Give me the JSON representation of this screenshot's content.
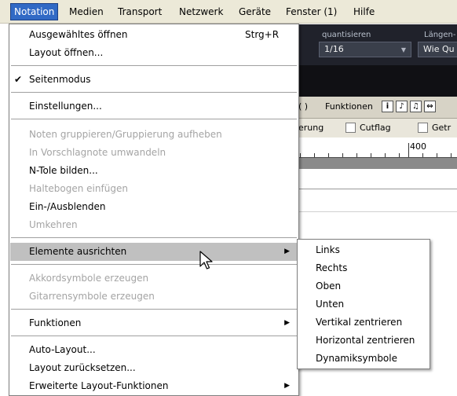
{
  "menubar": {
    "items": [
      "Notation",
      "Medien",
      "Transport",
      "Netzwerk",
      "Geräte",
      "Fenster (1)",
      "Hilfe"
    ]
  },
  "notation_menu": {
    "items": [
      {
        "label": "Ausgewähltes öffnen",
        "shortcut": "Strg+R"
      },
      {
        "label": "Layout öffnen..."
      },
      {
        "label": "Seitenmodus",
        "checked": true
      },
      {
        "label": "Einstellungen..."
      },
      {
        "label": "Noten gruppieren/Gruppierung aufheben",
        "disabled": true
      },
      {
        "label": "In Vorschlagnote umwandeln",
        "disabled": true
      },
      {
        "label": "N-Tole bilden..."
      },
      {
        "label": "Haltebogen einfügen",
        "disabled": true
      },
      {
        "label": "Ein-/Ausblenden"
      },
      {
        "label": "Umkehren",
        "disabled": true
      },
      {
        "label": "Elemente ausrichten",
        "submenu": true,
        "highlighted": true
      },
      {
        "label": "Akkordsymbole erzeugen",
        "disabled": true
      },
      {
        "label": "Gitarrensymbole erzeugen",
        "disabled": true
      },
      {
        "label": "Funktionen",
        "submenu": true
      },
      {
        "label": "Auto-Layout..."
      },
      {
        "label": "Layout zurücksetzen..."
      },
      {
        "label": "Erweiterte Layout-Funktionen",
        "submenu": true
      }
    ]
  },
  "submenu": {
    "items": [
      "Links",
      "Rechts",
      "Oben",
      "Unten",
      "Vertikal zentrieren",
      "Horizontal zentrieren",
      "Dynamiksymbole"
    ]
  },
  "background": {
    "quantize_label": "quantisieren",
    "quantize_value": "1/16",
    "length_label": "Längen-",
    "length_value": "Wie Qu",
    "functions_label": "Funktionen",
    "info_icon": "i",
    "toolbar_text": "erung",
    "cutflag_label": "Cutflag",
    "getr_label": "Getr",
    "ruler_number": "400"
  },
  "icons": {
    "check": "check-mark-icon",
    "submenu_arrow": "triangle-right-icon",
    "cursor": "arrow-pointer-icon"
  },
  "colors": {
    "menubar_bg": "#ece9d8",
    "active_menu": "#316ac5",
    "highlight": "#c0c0c0",
    "disabled_text": "#a4a4a4",
    "dark_toolbar": "#20222b"
  }
}
